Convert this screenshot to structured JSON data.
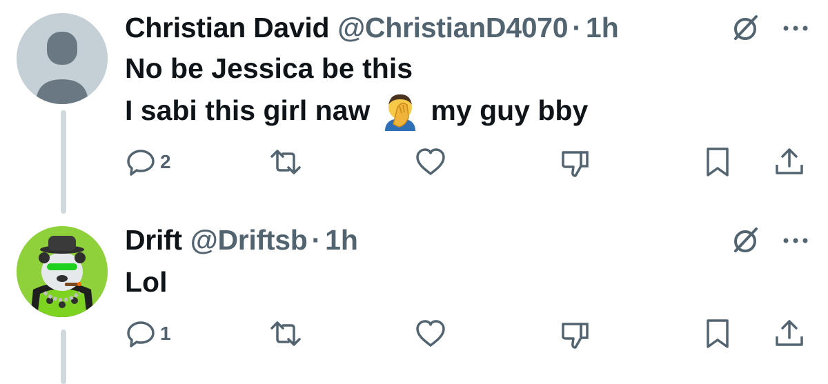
{
  "tweets": [
    {
      "name": "Christian David",
      "handle": "@ChristianD4070",
      "separator": "·",
      "time": "1h",
      "line1": "No be Jessica be this",
      "line2_before": "I sabi this girl naw",
      "line2_emoji": "face-palm-emoji",
      "line2_after": "my guy bby",
      "reply_count": "2",
      "avatar": "default-avatar"
    },
    {
      "name": "Drift",
      "handle": "@Driftsb",
      "separator": "·",
      "time": "1h",
      "line1": "Lol",
      "reply_count": "1",
      "avatar": "panda-with-hat-avatar"
    }
  ],
  "icons": {
    "reply": "reply-icon",
    "retweet": "retweet-icon",
    "like": "heart-icon",
    "dislike": "thumbs-down-icon",
    "bookmark": "bookmark-icon",
    "share": "share-icon",
    "grok": "grok-icon",
    "more": "more-icon"
  },
  "colors": {
    "text_primary": "#0f1419",
    "text_secondary": "#536471",
    "thread_line": "#cfd9de",
    "avatar_default_bg": "#c4cfd6",
    "avatar_green_bg": "#8ed13a"
  }
}
